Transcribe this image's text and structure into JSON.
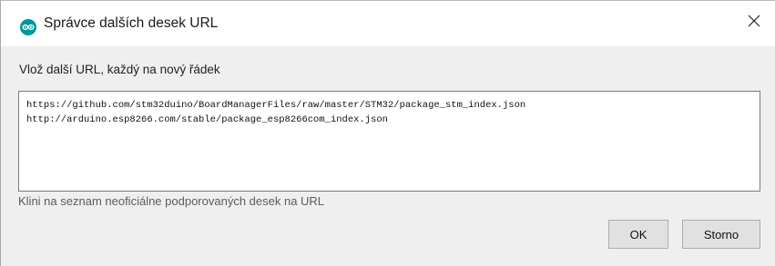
{
  "window": {
    "title": "Správce dalších desek URL",
    "app_icon": "arduino-icon",
    "close_glyph": "✕"
  },
  "dialog": {
    "prompt": "Vlož další URL, každý na nový řádek",
    "urls": [
      "https://github.com/stm32duino/BoardManagerFiles/raw/master/STM32/package_stm_index.json",
      "http://arduino.esp8266.com/stable/package_esp8266com_index.json"
    ],
    "unofficial_link": "Klini na seznam neoficiálne podporovaných desek na URL"
  },
  "buttons": {
    "ok": "OK",
    "cancel": "Storno"
  },
  "colors": {
    "arduino_teal": "#00979D",
    "dialog_background": "#EFEFEF"
  }
}
